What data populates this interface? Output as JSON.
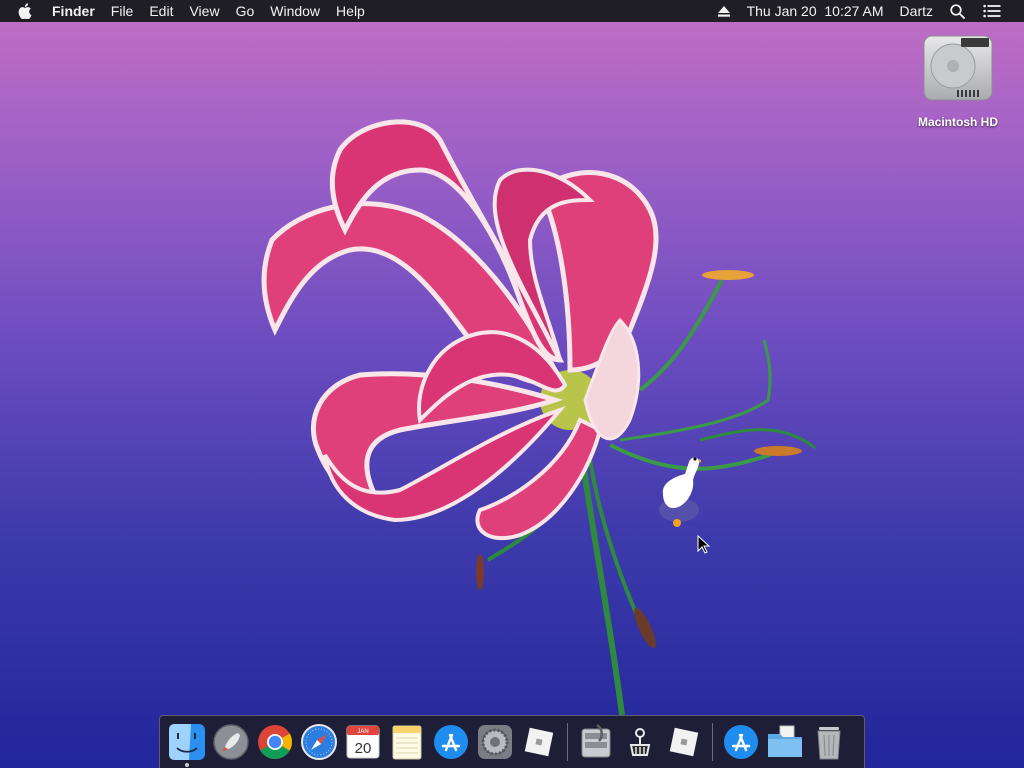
{
  "menubar": {
    "app_name": "Finder",
    "menus": [
      "File",
      "Edit",
      "View",
      "Go",
      "Window",
      "Help"
    ],
    "clock": "Thu Jan 20  10:27 AM",
    "user": "Dartz"
  },
  "desktop": {
    "icons": [
      {
        "label": "Macintosh HD",
        "icon": "hard-drive-icon"
      }
    ]
  },
  "dock": {
    "apps": [
      {
        "icon": "finder-icon",
        "running": true
      },
      {
        "icon": "launchpad-icon"
      },
      {
        "icon": "chrome-icon"
      },
      {
        "icon": "safari-icon"
      },
      {
        "icon": "calendar-icon",
        "month": "JAN",
        "day": "20"
      },
      {
        "icon": "notes-icon"
      },
      {
        "icon": "app-store-icon"
      },
      {
        "icon": "system-preferences-icon"
      },
      {
        "icon": "roblox-icon"
      }
    ],
    "apps2": [
      {
        "icon": "disk-utility-icon"
      },
      {
        "icon": "goose-app-icon"
      },
      {
        "icon": "roblox-icon"
      }
    ],
    "stacks": [
      {
        "icon": "app-store-icon"
      },
      {
        "icon": "downloads-folder-icon"
      },
      {
        "icon": "trash-icon"
      }
    ]
  },
  "colors": {
    "menubar_bg": "#1f1e24",
    "petal": "#e0407a",
    "stem": "#2e8a3e"
  }
}
